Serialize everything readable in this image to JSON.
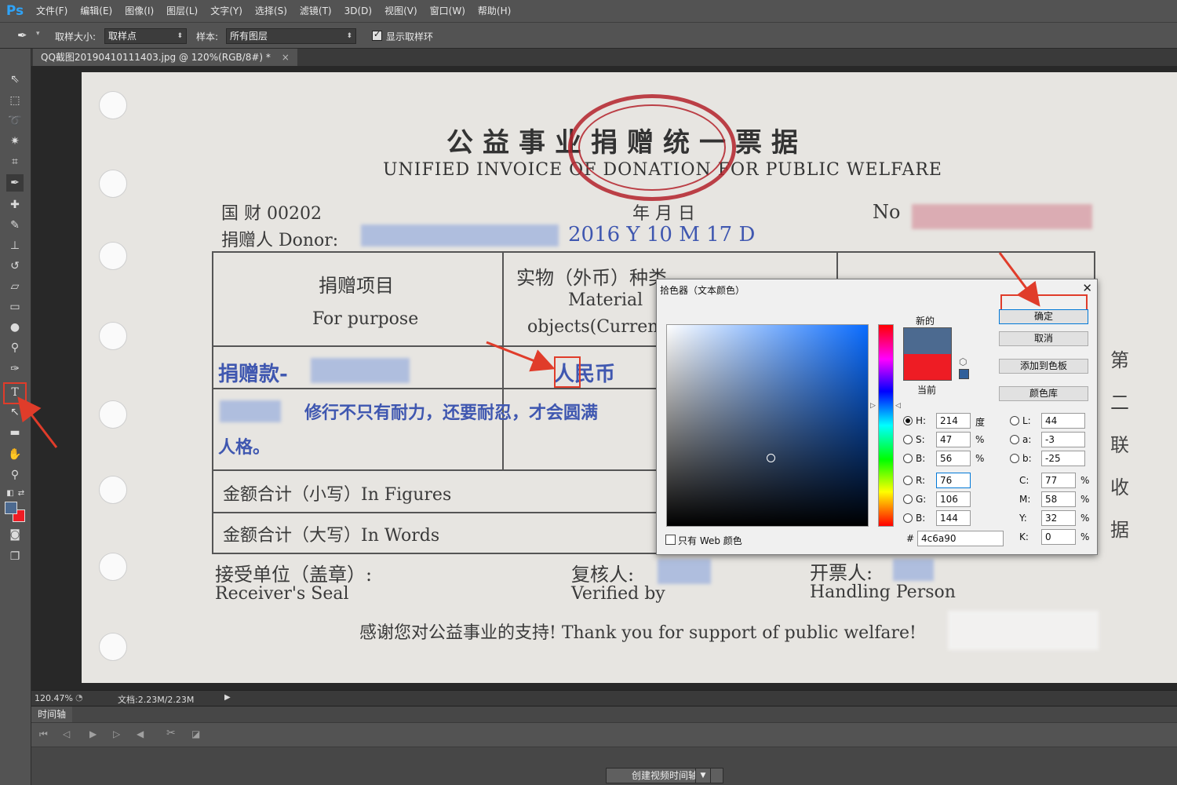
{
  "app": {
    "logo": "Ps"
  },
  "menu": [
    "文件(F)",
    "编辑(E)",
    "图像(I)",
    "图层(L)",
    "文字(Y)",
    "选择(S)",
    "滤镜(T)",
    "3D(D)",
    "视图(V)",
    "窗口(W)",
    "帮助(H)"
  ],
  "options": {
    "sample_size_label": "取样大小:",
    "sample_size_value": "取样点",
    "sample_label": "样本:",
    "sample_value": "所有图层",
    "show_ring_label": "显示取样环"
  },
  "document": {
    "tab_title": "QQ截图20190410111403.jpg @ 120%(RGB/8#) *",
    "close": "×"
  },
  "receipt": {
    "title": "公益事业捐赠统一票据",
    "subtitle": "UNIFIED INVOICE OF DONATION FOR PUBLIC WELFARE",
    "guocai": "国  财 00202",
    "date_labels": "年      月      日",
    "no_label": "No",
    "donor_label": "捐赠人 Donor:",
    "date_value": "2016  Y 10  M 17  D",
    "col_purpose_cn": "捐赠项目",
    "col_purpose_en": "For purpose",
    "col_material_cn": "实物（外币）种类",
    "col_material_en1": "Material",
    "col_material_en2": "objects(Currenc",
    "row1_text": "捐赠款-",
    "row1_currency": "人民币",
    "row2_text": "修行不只有耐力，还要耐忍，才会圆满",
    "row3_text": "人格。",
    "figures_label": "金额合计（小写）In Figures",
    "words_label": "金额合计（大写）In Words",
    "receiver_cn": "接受单位（盖章）:",
    "receiver_en": "Receiver's Seal",
    "verified_cn": "复核人:",
    "verified_en": "Verified by",
    "handler_cn": "开票人:",
    "handler_en": "Handling Person",
    "thanks": "感谢您对公益事业的支持! Thank you for support of public welfare!",
    "right_labels": [
      "第",
      "二",
      "联",
      "收",
      "据"
    ]
  },
  "status": {
    "zoom": "120.47%",
    "doc_size": "文档:2.23M/2.23M"
  },
  "timeline": {
    "tab": "时间轴",
    "create_button": "创建视频时间轴"
  },
  "color_picker": {
    "title": "拾色器（文本颜色）",
    "new_label": "新的",
    "current_label": "当前",
    "new_color": "#4c6a90",
    "current_color": "#ee1c24",
    "ok": "确定",
    "cancel": "取消",
    "add_swatch": "添加到色板",
    "color_libraries": "颜色库",
    "only_web": "只有 Web 颜色",
    "fields": {
      "H": {
        "label": "H:",
        "value": "214",
        "unit": "度"
      },
      "S": {
        "label": "S:",
        "value": "47",
        "unit": "%"
      },
      "Bv": {
        "label": "B:",
        "value": "56",
        "unit": "%"
      },
      "R": {
        "label": "R:",
        "value": "76"
      },
      "G": {
        "label": "G:",
        "value": "106"
      },
      "Bb": {
        "label": "B:",
        "value": "144"
      },
      "L": {
        "label": "L:",
        "value": "44"
      },
      "a": {
        "label": "a:",
        "value": "-3"
      },
      "b": {
        "label": "b:",
        "value": "-25"
      },
      "C": {
        "label": "C:",
        "value": "77",
        "unit": "%"
      },
      "M": {
        "label": "M:",
        "value": "58",
        "unit": "%"
      },
      "Y": {
        "label": "Y:",
        "value": "32",
        "unit": "%"
      },
      "K": {
        "label": "K:",
        "value": "0",
        "unit": "%"
      },
      "hex_label": "#",
      "hex": "4c6a90"
    }
  },
  "colors": {
    "accent_red": "#e03c2a",
    "ps_blue": "#2fa3f7"
  }
}
